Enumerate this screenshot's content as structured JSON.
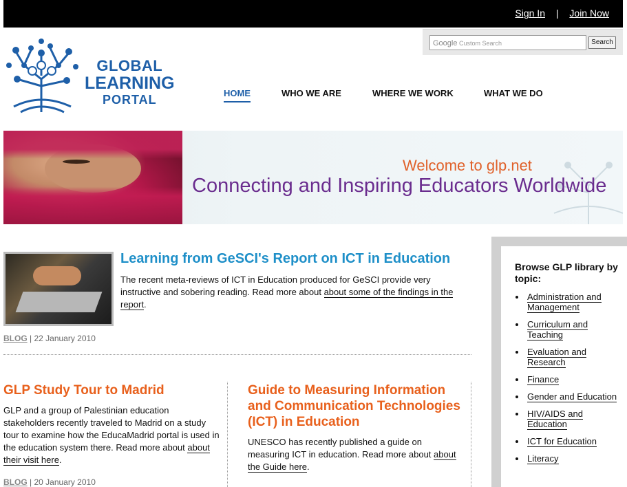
{
  "topbar": {
    "sign_in": "Sign In",
    "separator": "|",
    "join_now": "Join Now"
  },
  "logo": {
    "line1": "GLOBAL",
    "line2": "LEARNING",
    "line3": "PORTAL"
  },
  "search": {
    "google_label": "Google",
    "placeholder": "Custom Search",
    "button_label": "Search"
  },
  "nav": {
    "items": [
      {
        "label": "HOME",
        "active": true
      },
      {
        "label": "WHO WE ARE",
        "active": false
      },
      {
        "label": "WHERE WE WORK",
        "active": false
      },
      {
        "label": "WHAT WE DO",
        "active": false
      }
    ]
  },
  "banner": {
    "welcome": "Welcome to glp.net",
    "tagline": "Connecting and Inspiring Educators Worldwide"
  },
  "posts": [
    {
      "title": "Learning from GeSCI's Report on ICT in Education",
      "body": "The recent meta-reviews of ICT in Education produced for GeSCI provide very instructive and sobering reading. Read more about ",
      "link": "about some of the findings in the report",
      "end": ".",
      "tag": "BLOG",
      "date": "22 January 2010"
    },
    {
      "title": "GLP Study Tour to Madrid",
      "body": "GLP and a group of Palestinian education stakeholders recently traveled to Madrid on a study tour to examine how the EducaMadrid portal is used in the education system there. Read more about ",
      "link": "about their visit here",
      "end": ".",
      "tag": "BLOG",
      "date": "20 January 2010"
    },
    {
      "title": "Guide to Measuring Information and Communication Technologies (ICT) in Education",
      "body": "UNESCO has recently published a guide on measuring ICT in education. Read more about ",
      "link": "about the Guide here",
      "end": "."
    }
  ],
  "sidebar": {
    "heading": "Browse GLP library by topic:",
    "topics": [
      "Administration and Management",
      "Curriculum and Teaching",
      "Evaluation and Research",
      "Finance",
      "Gender and Education",
      "HIV/AIDS and Education",
      "ICT for Education",
      "Literacy"
    ]
  },
  "colors": {
    "brand_blue": "#1e5fa8",
    "title_blue": "#1e8fc8",
    "title_orange": "#e8601c",
    "welcome_orange": "#e0612a",
    "tagline_purple": "#6a2c8e"
  }
}
